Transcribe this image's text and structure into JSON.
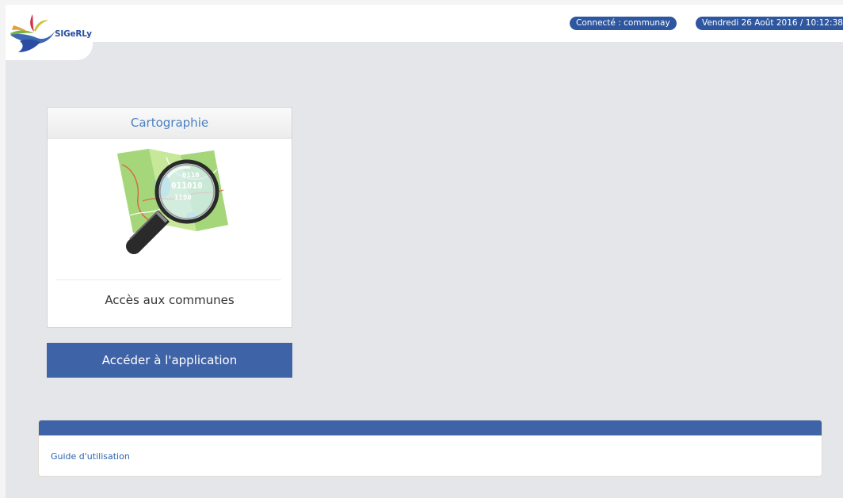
{
  "header": {
    "logo_text": "SIGeRLy",
    "connected_label": "Connecté : communay",
    "datetime_label": "Vendredi 26 Août 2016 / 10:12:38"
  },
  "app_card": {
    "title": "Cartographie",
    "description": "Accès aux communes",
    "button_label": "Accéder à l'application",
    "illustration_icon": "magnifier-over-map-icon",
    "illustration_text": [
      "0110",
      "011010",
      "1100"
    ]
  },
  "docs_panel": {
    "link_label": "Guide d'utilisation"
  },
  "colors": {
    "page_background": "#e5e6ea",
    "brand_blue": "#2e57a0",
    "button_blue": "#3f63a7",
    "title_blue": "#4a7fc2",
    "link_blue": "#2e63b0"
  }
}
